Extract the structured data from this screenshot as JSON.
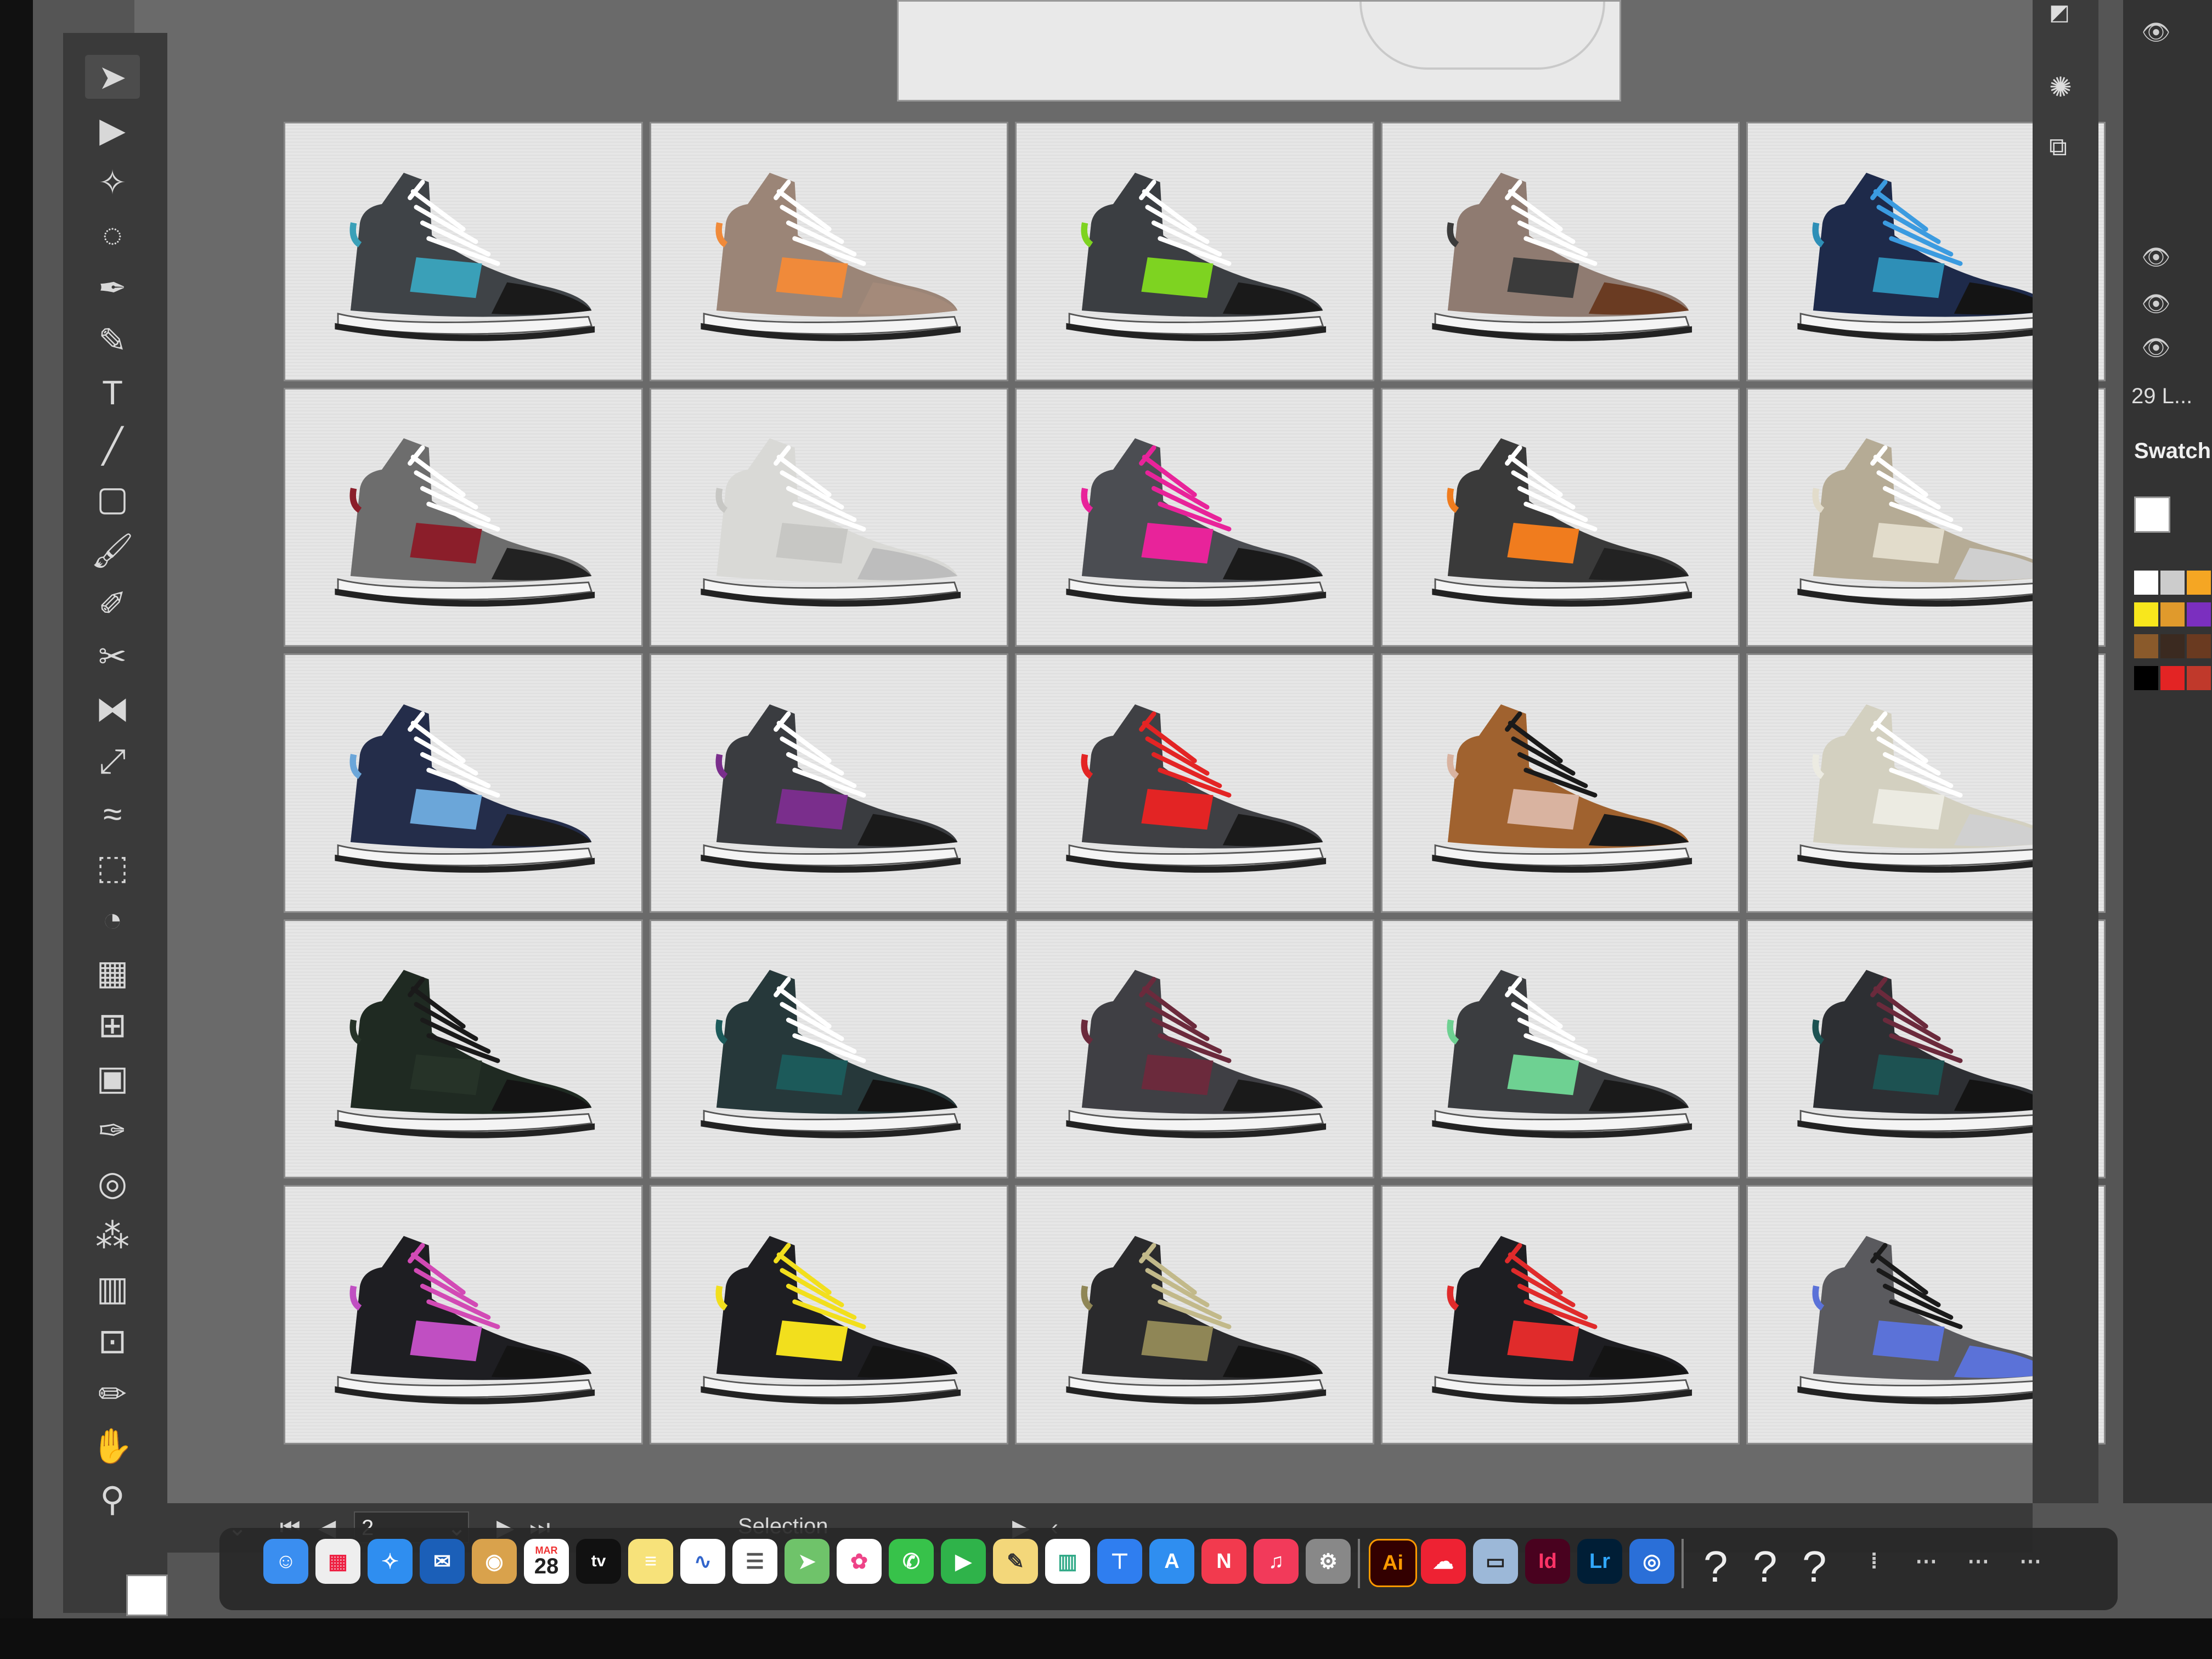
{
  "app": {
    "name": "Adobe Illustrator",
    "dock_icon_label": "Ai"
  },
  "toolbar": {
    "tools": [
      {
        "name": "selection-tool",
        "glyph": "➤"
      },
      {
        "name": "direct-selection-tool",
        "glyph": "▶"
      },
      {
        "name": "magic-wand-tool",
        "glyph": "✧"
      },
      {
        "name": "lasso-tool",
        "glyph": "◌"
      },
      {
        "name": "pen-tool",
        "glyph": "✒"
      },
      {
        "name": "curvature-tool",
        "glyph": "✎"
      },
      {
        "name": "type-tool",
        "glyph": "T"
      },
      {
        "name": "line-segment-tool",
        "glyph": "╱"
      },
      {
        "name": "rectangle-tool",
        "glyph": "▢"
      },
      {
        "name": "paintbrush-tool",
        "glyph": "🖌"
      },
      {
        "name": "shaper-tool",
        "glyph": "✐"
      },
      {
        "name": "scissors-tool",
        "glyph": "✂"
      },
      {
        "name": "reflect-tool",
        "glyph": "⧓"
      },
      {
        "name": "scale-tool",
        "glyph": "⤢"
      },
      {
        "name": "width-tool",
        "glyph": "≈"
      },
      {
        "name": "free-transform-tool",
        "glyph": "⬚"
      },
      {
        "name": "shape-builder-tool",
        "glyph": "◔"
      },
      {
        "name": "perspective-grid-tool",
        "glyph": "▦"
      },
      {
        "name": "mesh-tool",
        "glyph": "⊞"
      },
      {
        "name": "gradient-tool",
        "glyph": "▣"
      },
      {
        "name": "eyedropper-tool",
        "glyph": "✑"
      },
      {
        "name": "blend-tool",
        "glyph": "◎"
      },
      {
        "name": "symbol-sprayer-tool",
        "glyph": "⁂"
      },
      {
        "name": "column-graph-tool",
        "glyph": "▥"
      },
      {
        "name": "artboard-tool",
        "glyph": "⊡"
      },
      {
        "name": "slice-tool",
        "glyph": "✏"
      },
      {
        "name": "hand-tool",
        "glyph": "✋"
      },
      {
        "name": "zoom-tool",
        "glyph": "⚲"
      }
    ]
  },
  "artboards": [
    {
      "upper": "#3f4347",
      "accent": "#3aa0b8",
      "lace": "#ffffff",
      "toe": "#1a1a1a"
    },
    {
      "upper": "#9b8577",
      "accent": "#f08a3a",
      "lace": "#ffffff",
      "toe": "#a48a7a"
    },
    {
      "upper": "#3b3e42",
      "accent": "#7ed321",
      "lace": "#ffffff",
      "toe": "#1a1a1a"
    },
    {
      "upper": "#8f7b71",
      "accent": "#3b3b3b",
      "lace": "#ffffff",
      "toe": "#6a3b22"
    },
    {
      "upper": "#1e2a4a",
      "accent": "#2e8fb7",
      "lace": "#3b9be0",
      "toe": "#141414"
    },
    {
      "upper": "#6d6d6d",
      "accent": "#8b1e2a",
      "lace": "#ffffff",
      "toe": "#222222"
    },
    {
      "upper": "#d9d9d6",
      "accent": "#c7c7c4",
      "lace": "#ffffff",
      "toe": "#bdbdbd"
    },
    {
      "upper": "#4b4d52",
      "accent": "#e8239a",
      "lace": "#e8239a",
      "toe": "#1a1a1a"
    },
    {
      "upper": "#3a3a3a",
      "accent": "#f07c1e",
      "lace": "#ffffff",
      "toe": "#222222"
    },
    {
      "upper": "#b5ab95",
      "accent": "#e2dccb",
      "lace": "#ffffff",
      "toe": "#cfcfcf"
    },
    {
      "upper": "#242d4a",
      "accent": "#6ba6d9",
      "lace": "#ffffff",
      "toe": "#1a1a1a"
    },
    {
      "upper": "#3a3c40",
      "accent": "#7a2e8c",
      "lace": "#ffffff",
      "toe": "#1a1a1a"
    },
    {
      "upper": "#3f4044",
      "accent": "#e32424",
      "lace": "#e32424",
      "toe": "#1a1a1a"
    },
    {
      "upper": "#a0622f",
      "accent": "#d9b3a0",
      "lace": "#1a1a1a",
      "toe": "#1a1a1a"
    },
    {
      "upper": "#d3d0c0",
      "accent": "#ecebe2",
      "lace": "#ffffff",
      "toe": "#d0d0d0"
    },
    {
      "upper": "#1f2a22",
      "accent": "#263328",
      "lace": "#1a1a1a",
      "toe": "#141414"
    },
    {
      "upper": "#26383a",
      "accent": "#1c5a5a",
      "lace": "#ffffff",
      "toe": "#141414"
    },
    {
      "upper": "#3f3f44",
      "accent": "#6b2a3c",
      "lace": "#6b2a3c",
      "toe": "#1a1a1a"
    },
    {
      "upper": "#3b3d40",
      "accent": "#6ed192",
      "lace": "#ffffff",
      "toe": "#1a1a1a"
    },
    {
      "upper": "#2d2f33",
      "accent": "#1d5252",
      "lace": "#6b2a3c",
      "toe": "#141414"
    },
    {
      "upper": "#1e1e22",
      "accent": "#c04fc2",
      "lace": "#d24ab5",
      "toe": "#141414"
    },
    {
      "upper": "#1e1e22",
      "accent": "#f2df1d",
      "lace": "#f2df1d",
      "toe": "#141414"
    },
    {
      "upper": "#2a2a2c",
      "accent": "#8f8656",
      "lace": "#c2b98a",
      "toe": "#141414"
    },
    {
      "upper": "#1e1e22",
      "accent": "#e02b2b",
      "lace": "#e02b2b",
      "toe": "#141414"
    },
    {
      "upper": "#5a5a5e",
      "accent": "#5b72d8",
      "lace": "#1a1a1a",
      "toe": "#5b72d8"
    }
  ],
  "right_panel": {
    "layers_count": "29 L...",
    "swatches_title": "Swatch",
    "swatch_colors": [
      "#ffffff",
      "#cccccc",
      "#f5a623",
      "#f8e71c",
      "#e09a2c",
      "#7b2fbf",
      "#8a5a2b",
      "#3b2a20",
      "#6a3a20",
      "#000000",
      "#e32424",
      "#c0392b"
    ]
  },
  "statusbar": {
    "page_value": "2",
    "tool_label": "Selection"
  },
  "dock": {
    "calendar_day": "28",
    "calendar_month": "MAR",
    "tv_label": "tv",
    "indesign_label": "Id",
    "lightroom_label": "Lr",
    "help_glyphs": [
      "?",
      "?",
      "?"
    ]
  }
}
